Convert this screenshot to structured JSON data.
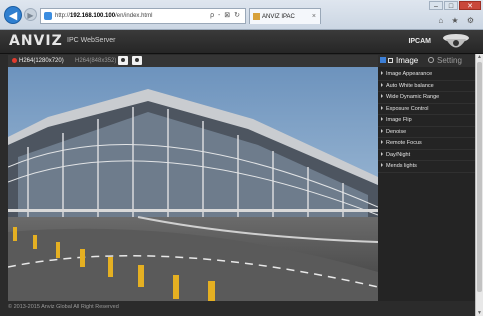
{
  "browser": {
    "url_prefix": "http://",
    "url_host": "192.168.100.100",
    "url_path": "/en/index.html",
    "address_tools": "ρ - ⊠ ↻",
    "tab_title": "ANVIZ IPAC",
    "tab_close": "×",
    "win_min": "–",
    "win_max": "□",
    "win_close": "✕",
    "toolbar_icons": "⌂ ★ ⚙"
  },
  "app": {
    "logo": "ANVIZ",
    "subtitle": "IPC WebServer",
    "device_name": "IPCAM"
  },
  "stream": {
    "main": "H264(1280x720)",
    "sub": "H264(848x352)"
  },
  "panel": {
    "tab_image": "Image",
    "tab_setting": "Setting",
    "items": [
      {
        "label": "Image Appearance"
      },
      {
        "label": "Auto White balance"
      },
      {
        "label": "Wide Dynamic Range"
      },
      {
        "label": "Exposure Control"
      },
      {
        "label": "Image Flip"
      },
      {
        "label": "Denoise"
      },
      {
        "label": "Remote Focus"
      },
      {
        "label": "Day/Night"
      },
      {
        "label": "Mends lights"
      }
    ]
  },
  "footer": {
    "copyright": "© 2013-2015 Anviz Global All Right Reserved"
  },
  "colors": {
    "accent_red": "#e23b2e",
    "accent_blue": "#3d7fd6",
    "panel_bg": "#242424",
    "header_bg": "#2b2b2b"
  },
  "icons": [
    "back-arrow-icon",
    "forward-arrow-icon",
    "snapshot-icon",
    "record-icon",
    "image-icon",
    "gear-icon",
    "camera-icon"
  ]
}
